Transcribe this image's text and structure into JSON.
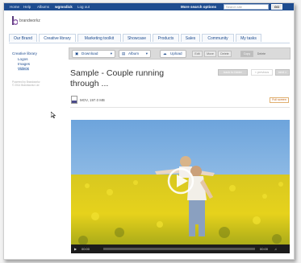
{
  "topnav": {
    "links": [
      "Home",
      "Help",
      "Albums",
      "wgmsdick",
      "Log out"
    ],
    "more_options": "More search options",
    "search_placeholder": "Search site",
    "go": "GO"
  },
  "logo": {
    "text": "brandworkz"
  },
  "tabs": [
    "Our Brand",
    "Creative library",
    "Marketing toolkit",
    "Showcase",
    "Products",
    "Sales",
    "Community",
    "My tasks"
  ],
  "sidebar": {
    "heading": "Creative library",
    "items": [
      "Logos",
      "Images",
      "Videos"
    ],
    "powered": "Powered by Brandworkz",
    "copyright": "© 2014 Brandworkz Ltd"
  },
  "toolbar": {
    "download": "Download",
    "album": "Album",
    "upload": "Upload",
    "edit": "Edit",
    "move": "Move",
    "delete": "Delete",
    "copy": "Copy",
    "delete2": "Delete"
  },
  "asset": {
    "title_line1": "Sample - Couple running",
    "title_line2": "through ...",
    "file_info": "MOV, 197.0 MB",
    "full_screen": "Full screen"
  },
  "navigation": {
    "back": "back to folder",
    "previous": "< previous",
    "next": "next >"
  },
  "player": {
    "time_current": "00:00",
    "time_total": "00:00"
  },
  "colors": {
    "topbar": "#1e4c8f",
    "link": "#1e4c8f",
    "field": "#e8d020",
    "sky": "#7fb0e0"
  }
}
